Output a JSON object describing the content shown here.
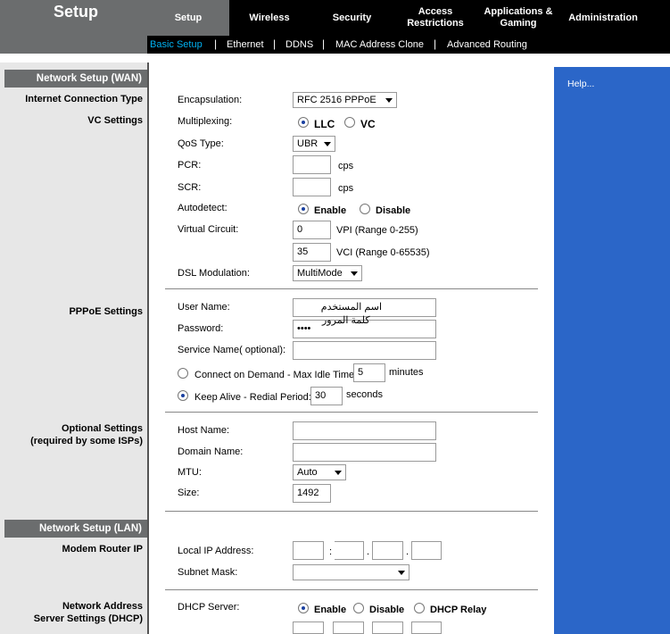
{
  "app": {
    "title": "Setup"
  },
  "tabs": [
    {
      "label": "Setup",
      "active": true
    },
    {
      "label": "Wireless"
    },
    {
      "label": "Security"
    },
    {
      "label": "Access\nRestrictions"
    },
    {
      "label": "Applications &\nGaming"
    },
    {
      "label": "Administration"
    }
  ],
  "subtabs": [
    {
      "label": "Basic Setup",
      "active": true
    },
    {
      "label": "Ethernet"
    },
    {
      "label": "DDNS"
    },
    {
      "label": "MAC Address Clone"
    },
    {
      "label": "Advanced Routing"
    }
  ],
  "help": "Help...",
  "left": {
    "wan_header": "Network Setup (WAN)",
    "conn_type": "Internet Connection Type",
    "vc_settings": "VC Settings",
    "pppoe_settings": "PPPoE Settings",
    "optional_settings_1": "Optional Settings",
    "optional_settings_2": "(required by some ISPs)",
    "lan_header": "Network Setup (LAN)",
    "modem_router_ip": "Modem Router IP",
    "nas_1": "Network Address",
    "nas_2": "Server Settings (DHCP)"
  },
  "wan": {
    "encapsulation_label": "Encapsulation:",
    "encapsulation_value": "RFC 2516 PPPoE",
    "multiplexing_label": "Multiplexing:",
    "llc": "LLC",
    "vc": "VC",
    "qos_label": "QoS Type:",
    "qos_value": "UBR",
    "pcr_label": "PCR:",
    "pcr_unit": "cps",
    "scr_label": "SCR:",
    "scr_unit": "cps",
    "autodetect_label": "Autodetect:",
    "enable": "Enable",
    "disable": "Disable",
    "virtual_circuit_label": "Virtual Circuit:",
    "vpi_value": "0",
    "vpi_unit": "VPI (Range 0-255)",
    "vci_value": "35",
    "vci_unit": "VCI (Range 0-65535)",
    "dsl_label": "DSL Modulation:",
    "dsl_value": "MultiMode"
  },
  "pppoe": {
    "username_label": "User Name:",
    "username_value": "اسم المستخدم",
    "password_label": "Password:",
    "password_value": "••••",
    "password_overlay": "كلمة المرور",
    "service_label": "Service Name( optional):",
    "connect_demand": "Connect on Demand - Max Idle Time:",
    "idle_value": "5",
    "idle_unit": "minutes",
    "keep_alive": "Keep Alive - Redial Period:",
    "redial_value": "30",
    "redial_unit": "seconds"
  },
  "optional": {
    "host_label": "Host Name:",
    "domain_label": "Domain Name:",
    "mtu_label": "MTU:",
    "mtu_value": "Auto",
    "size_label": "Size:",
    "size_value": "1492"
  },
  "lan": {
    "local_ip_label": "Local IP Address:",
    "subnet_label": "Subnet Mask:"
  },
  "dhcp": {
    "server_label": "DHCP Server:",
    "enable": "Enable",
    "disable": "Disable",
    "relay": "DHCP Relay"
  }
}
